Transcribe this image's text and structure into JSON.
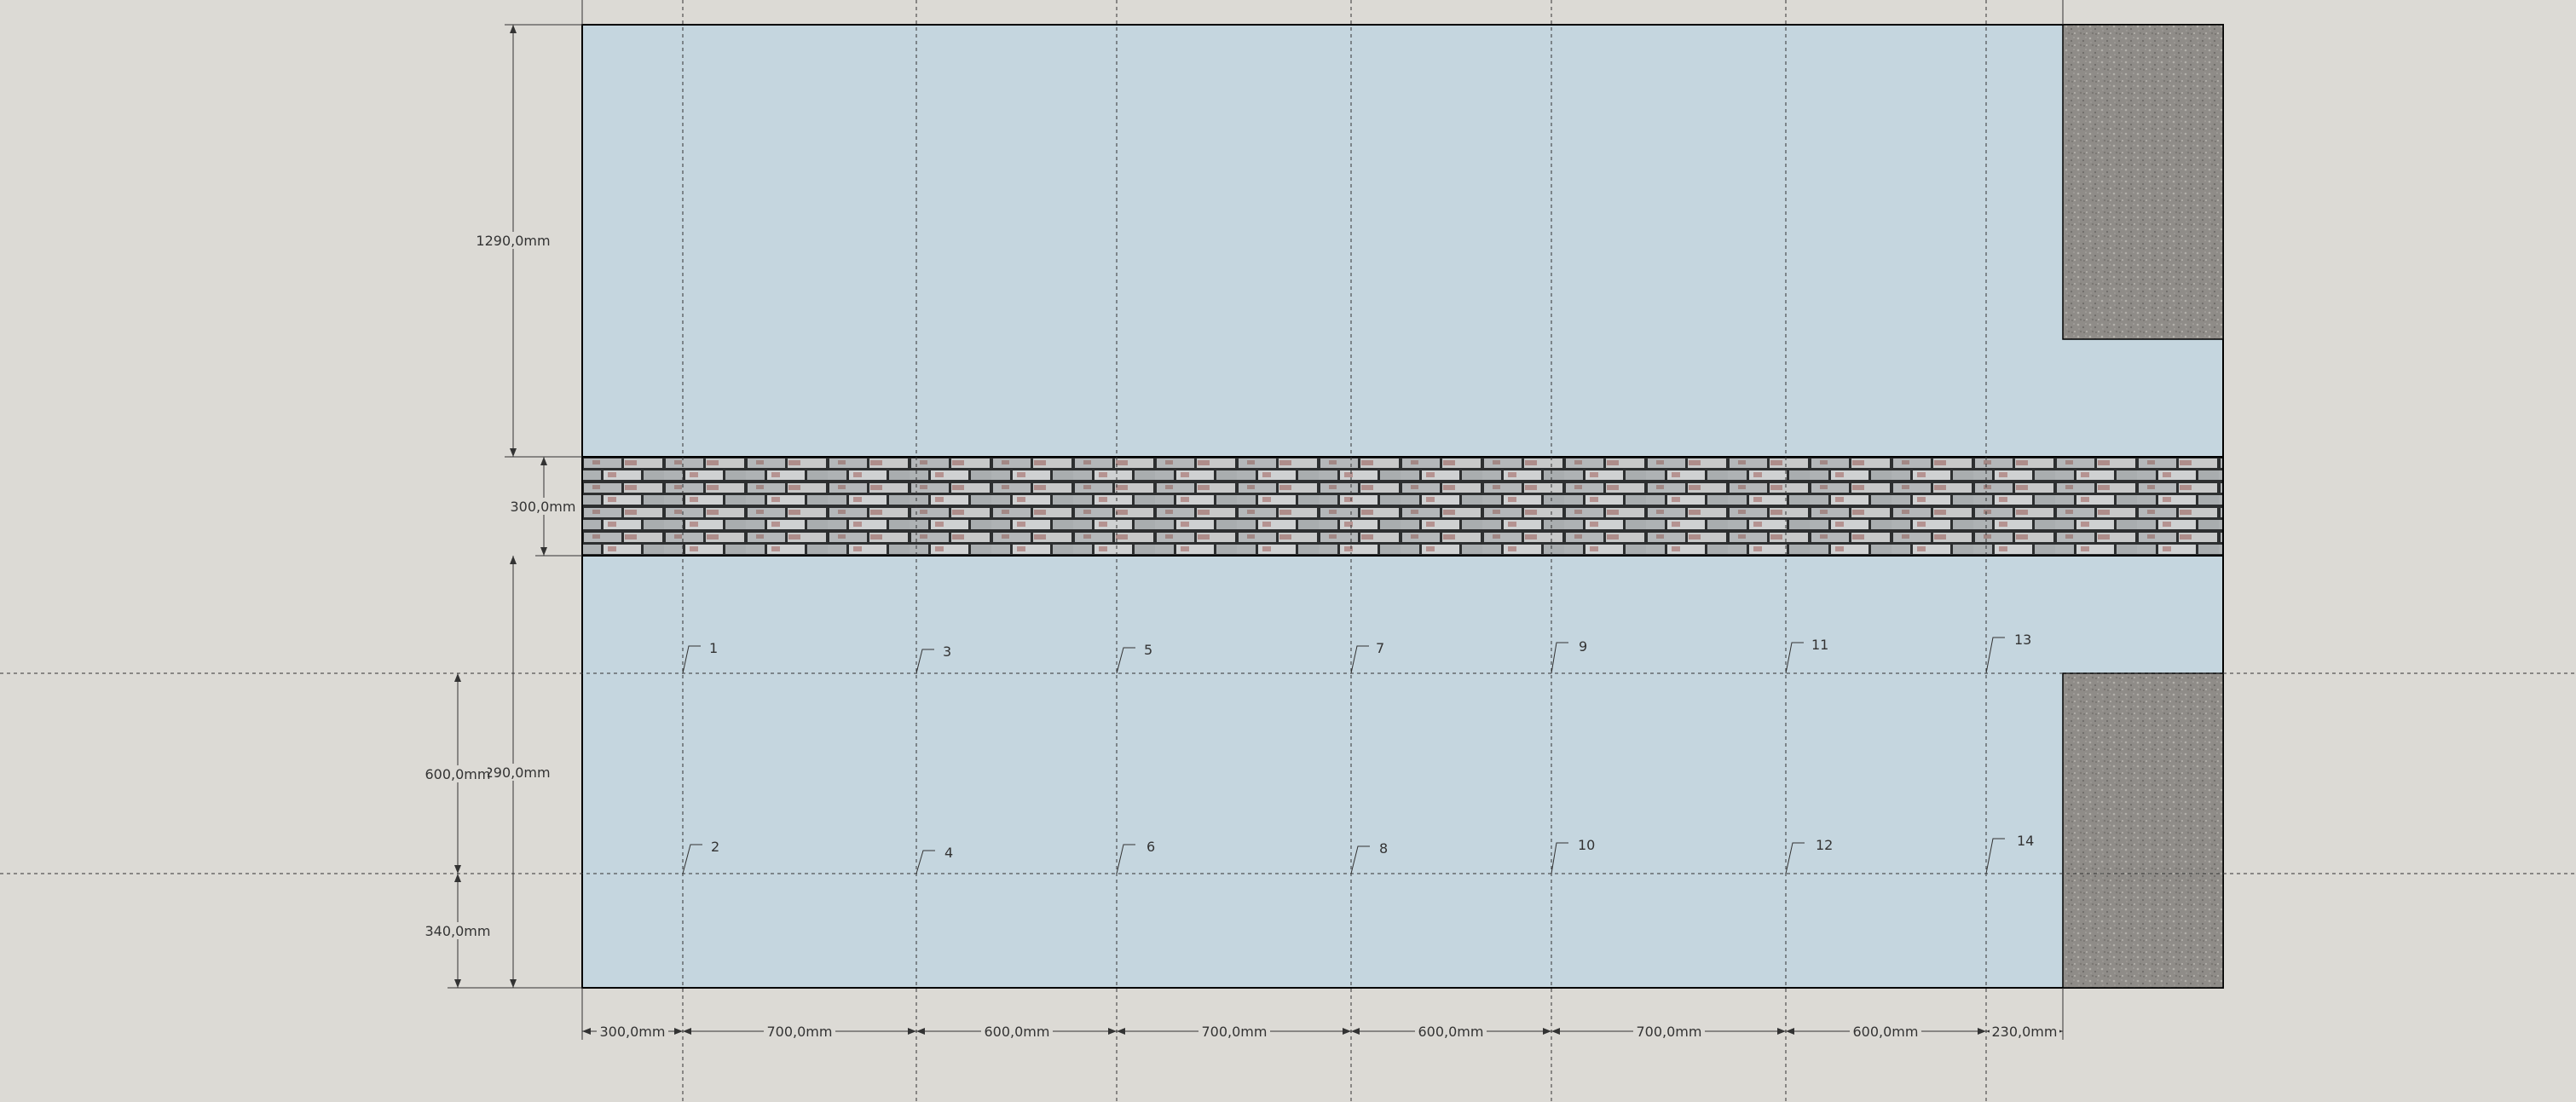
{
  "colors": {
    "background": "#dcdad5",
    "panel": "#c5d6df",
    "outline": "#000000",
    "guide": "#333333",
    "gravel": "#8f8c88"
  },
  "dimensions": {
    "horizontal": [
      "300,0mm",
      "700,0mm",
      "600,0mm",
      "700,0mm",
      "600,0mm",
      "700,0mm",
      "600,0mm",
      "230,0mm"
    ],
    "vertical": {
      "upper_panel": "1290,0mm",
      "brick_band": "300,0mm",
      "lower_panel": "1290,0mm",
      "upper_row_offset": "600,0mm",
      "lower_row_offset": "340,0mm"
    }
  },
  "point_labels": {
    "top_row": [
      "1",
      "3",
      "5",
      "7",
      "9",
      "11",
      "13"
    ],
    "bottom_row": [
      "2",
      "4",
      "6",
      "8",
      "10",
      "12",
      "14"
    ]
  },
  "materials": {
    "band": "brick-texture",
    "corner_fill": "gravel-texture"
  }
}
